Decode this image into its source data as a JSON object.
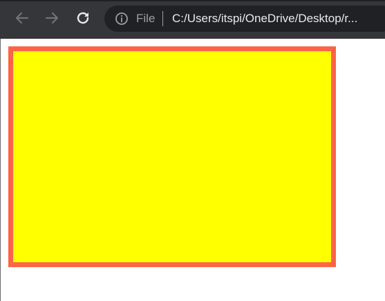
{
  "toolbar": {
    "back_icon": "arrow-left-icon",
    "forward_icon": "arrow-right-icon",
    "reload_icon": "reload-icon"
  },
  "address_bar": {
    "security_icon": "info-icon",
    "scheme_label": "File",
    "url": "C:/Users/itspi/OneDrive/Desktop/r..."
  },
  "page": {
    "box_fill_color": "#ffff00",
    "box_border_color": "#ff6347"
  },
  "colors": {
    "toolbar_background": "#35363a",
    "omnibox_background": "#202124",
    "url_text": "#e8eaed",
    "muted_text": "#9aa0a6"
  }
}
